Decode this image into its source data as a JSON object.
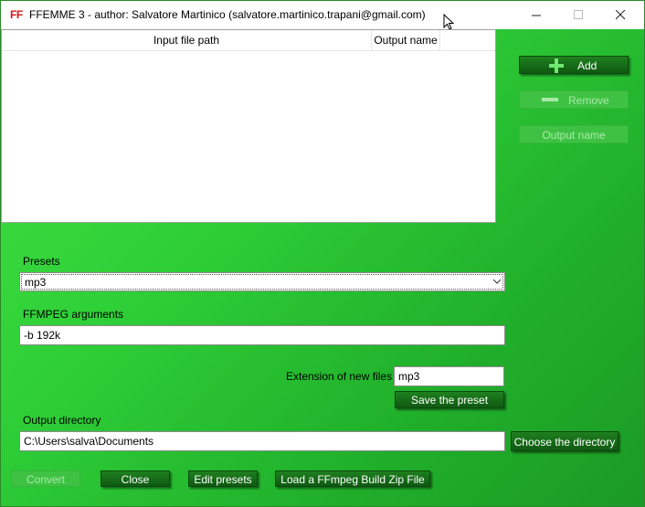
{
  "window": {
    "logo": "FF",
    "title": "FFEMME 3 - author: Salvatore Martinico (salvatore.martinico.trapani@gmail.com)"
  },
  "file_list": {
    "columns": [
      "Input file path",
      "Output name"
    ],
    "rows": []
  },
  "side_buttons": {
    "add": "Add",
    "remove": "Remove",
    "output_name": "Output name"
  },
  "presets": {
    "label": "Presets",
    "selected": "mp3"
  },
  "ffmpeg_args": {
    "label": "FFMPEG arguments",
    "value": "-b 192k"
  },
  "extension": {
    "label": "Extension of new files",
    "value": "mp3"
  },
  "save_preset": "Save the preset",
  "output_dir": {
    "label": "Output directory",
    "value": "C:\\Users\\salva\\Documents",
    "choose": "Choose the directory"
  },
  "bottom_buttons": {
    "convert": "Convert",
    "close": "Close",
    "edit_presets": "Edit presets",
    "load_zip": "Load a FFmpeg Build Zip File"
  },
  "colors": {
    "accent": "#1f7f1f",
    "background": "#2fcf38",
    "logo": "#d01818"
  }
}
